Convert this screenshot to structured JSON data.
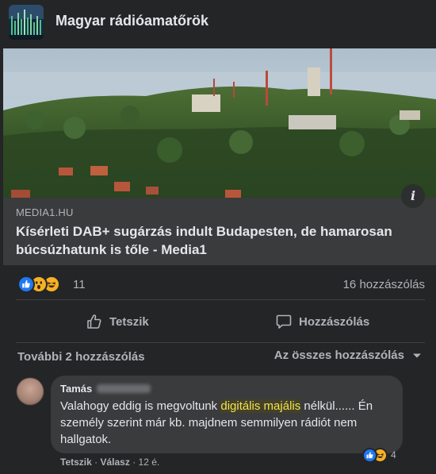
{
  "group": {
    "name": "Magyar rádióamatőrök"
  },
  "link": {
    "domain": "MEDIA1.HU",
    "title": "Kísérleti DAB+ sugárzás indult Budapesten, de hamarosan búcsúzhatunk is tőle - Media1",
    "info_icon_glyph": "i"
  },
  "stats": {
    "reaction_count": "11",
    "comment_count": "16 hozzászólás"
  },
  "actions": {
    "like_label": "Tetszik",
    "comment_label": "Hozzászólás"
  },
  "comments_bar": {
    "more_label": "További 2 hozzászólás",
    "filter_label": "Az összes hozzászólás"
  },
  "comment": {
    "author": "Tamás",
    "text_before": "Valahogy eddig is megvoltunk ",
    "highlight": "digitális majális",
    "text_after": " nélkül...... Én személy szerint már kb. majdnem semmilyen rádiót nem hallgatok.",
    "like_action": "Tetszik",
    "reply_action": "Válasz",
    "age": "12 é.",
    "reaction_count": "4",
    "separator": "·"
  },
  "colors": {
    "background": "#242526",
    "card": "#3a3b3c",
    "like_blue": "#2078f4",
    "emoji_yellow": "#f7b125",
    "highlight_text": "#ede54a"
  }
}
